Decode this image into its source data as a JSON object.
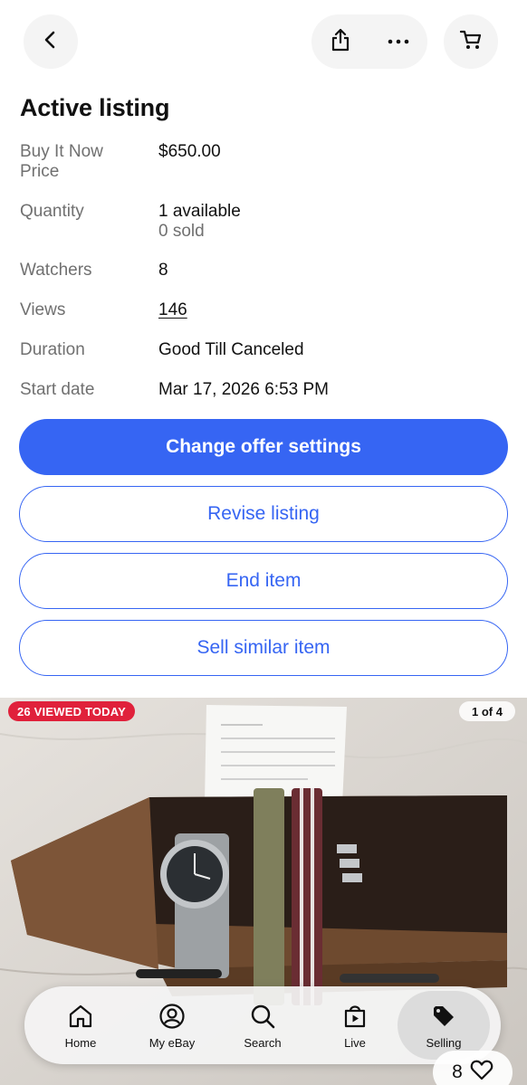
{
  "header": {
    "back_icon": "chevron-left-icon",
    "share_icon": "share-icon",
    "more_icon": "more-horizontal-icon",
    "cart_icon": "cart-icon"
  },
  "listing": {
    "title": "Active listing",
    "rows": [
      {
        "label": "Buy It Now Price",
        "value": "$650.00"
      },
      {
        "label": "Quantity",
        "value": "1 available",
        "sub": "0 sold"
      },
      {
        "label": "Watchers",
        "value": "8"
      },
      {
        "label": "Views",
        "value": "146"
      },
      {
        "label": "Duration",
        "value": "Good Till Canceled"
      },
      {
        "label": "Start date",
        "value": "Mar 17, 2026 6:53 PM"
      }
    ]
  },
  "actions": {
    "change_offer": "Change offer settings",
    "revise": "Revise listing",
    "end": "End item",
    "sell_similar": "Sell similar item",
    "primary_color": "#3665f3"
  },
  "gallery": {
    "viewed_badge": "26 VIEWED TODAY",
    "counter": "1 of 4",
    "badge_color": "#e0213b"
  },
  "nav": {
    "items": [
      {
        "label": "Home",
        "icon": "home-icon"
      },
      {
        "label": "My eBay",
        "icon": "user-circle-icon"
      },
      {
        "label": "Search",
        "icon": "search-icon"
      },
      {
        "label": "Live",
        "icon": "live-bag-icon"
      },
      {
        "label": "Selling",
        "icon": "price-tag-icon",
        "active": true
      }
    ]
  },
  "watch": {
    "count": "8",
    "icon": "heart-icon"
  }
}
